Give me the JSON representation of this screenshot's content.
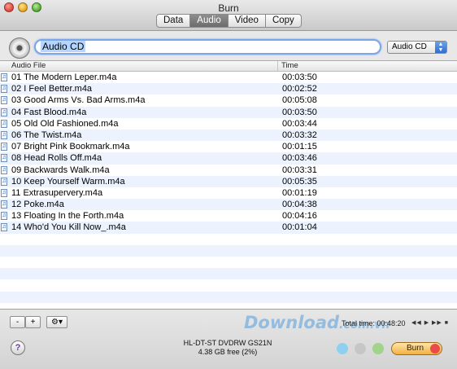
{
  "window": {
    "title": "Burn"
  },
  "tabs": [
    {
      "label": "Data",
      "active": false
    },
    {
      "label": "Audio",
      "active": true
    },
    {
      "label": "Video",
      "active": false
    },
    {
      "label": "Copy",
      "active": false
    }
  ],
  "disc": {
    "name_value": "Audio CD",
    "type_selected": "Audio CD"
  },
  "table": {
    "headers": {
      "file": "Audio File",
      "time": "Time"
    },
    "rows": [
      {
        "file": "01 The Modern Leper.m4a",
        "time": "00:03:50"
      },
      {
        "file": "02 I Feel Better.m4a",
        "time": "00:02:52"
      },
      {
        "file": "03 Good Arms Vs. Bad Arms.m4a",
        "time": "00:05:08"
      },
      {
        "file": "04 Fast Blood.m4a",
        "time": "00:03:50"
      },
      {
        "file": "05 Old Old Fashioned.m4a",
        "time": "00:03:44"
      },
      {
        "file": "06 The Twist.m4a",
        "time": "00:03:32"
      },
      {
        "file": "07 Bright Pink Bookmark.m4a",
        "time": "00:01:15"
      },
      {
        "file": "08 Head Rolls Off.m4a",
        "time": "00:03:46"
      },
      {
        "file": "09 Backwards Walk.m4a",
        "time": "00:03:31"
      },
      {
        "file": "10 Keep Yourself Warm.m4a",
        "time": "00:05:35"
      },
      {
        "file": "11 Extrasupervery.m4a",
        "time": "00:01:19"
      },
      {
        "file": "12 Poke.m4a",
        "time": "00:04:38"
      },
      {
        "file": "13 Floating In the Forth.m4a",
        "time": "00:04:16"
      },
      {
        "file": "14 Who'd You Kill Now_.m4a",
        "time": "00:01:04"
      }
    ]
  },
  "controls": {
    "remove_label": "-",
    "add_label": "+",
    "gear_label": "⚙▾",
    "total_time": "Total time: 00:48:20",
    "transport": "◀◀ ▶ ▶▶ ■",
    "help_label": "?",
    "drive_name": "HL-DT-ST DVDRW GS21N",
    "drive_free": "4.38 GB free (2%)",
    "burn_label": "Burn",
    "watermark_main": "Download",
    "watermark_sub": ".com.vn"
  },
  "colors": {
    "dot_blue": "#8fd0f0",
    "dot_gray": "#c6c6c6",
    "dot_green": "#9fd48a",
    "dot_red": "#f08a8a"
  },
  "icons": {
    "disc": "cd-icon",
    "file": "music-note-icon",
    "help": "help-icon",
    "gear": "gear-icon"
  }
}
